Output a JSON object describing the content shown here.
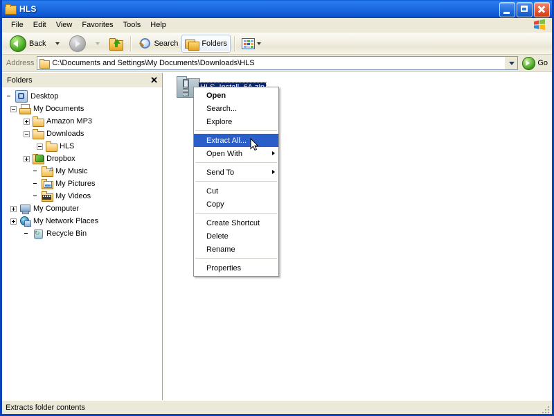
{
  "window": {
    "title": "HLS",
    "title_icon": "folder-icon",
    "buttons": {
      "minimize": "minimize",
      "maximize": "maximize",
      "close": "close"
    }
  },
  "menubar": {
    "items": [
      "File",
      "Edit",
      "View",
      "Favorites",
      "Tools",
      "Help"
    ],
    "brand_icon": "windows-flag-icon"
  },
  "toolbar": {
    "back": {
      "label": "Back",
      "icon": "back-arrow-icon",
      "enabled": true
    },
    "forward": {
      "label": "",
      "icon": "forward-arrow-icon",
      "enabled": false
    },
    "up": {
      "label": "",
      "icon": "up-folder-icon"
    },
    "search": {
      "label": "Search",
      "icon": "magnifier-icon"
    },
    "folders": {
      "label": "Folders",
      "icon": "folders-icon",
      "pressed": true
    },
    "views": {
      "label": "",
      "icon": "views-icon"
    }
  },
  "address": {
    "label": "Address",
    "icon": "folder-icon",
    "value": "C:\\Documents and Settings\\My Documents\\Downloads\\HLS",
    "dropdown_icon": "chevron-down-icon",
    "go_label": "Go",
    "go_icon": "go-arrow-icon"
  },
  "folders_pane": {
    "title": "Folders",
    "close_icon": "close-icon",
    "tree": [
      {
        "label": "Desktop",
        "icon": "desktop-icon",
        "indent": 0,
        "expander": "none"
      },
      {
        "label": "My Documents",
        "icon": "my-documents-icon",
        "indent": 1,
        "expander": "minus"
      },
      {
        "label": "Amazon MP3",
        "icon": "folder-icon",
        "indent": 2,
        "expander": "plus"
      },
      {
        "label": "Downloads",
        "icon": "folder-icon",
        "indent": 2,
        "expander": "minus"
      },
      {
        "label": "HLS",
        "icon": "folder-icon",
        "indent": 3,
        "expander": "minus"
      },
      {
        "label": "Dropbox",
        "icon": "dropbox-icon",
        "indent": 2,
        "expander": "plus"
      },
      {
        "label": "My Music",
        "icon": "my-music-icon",
        "indent": 2,
        "expander": "none"
      },
      {
        "label": "My Pictures",
        "icon": "my-pictures-icon",
        "indent": 2,
        "expander": "none"
      },
      {
        "label": "My Videos",
        "icon": "my-videos-icon",
        "indent": 2,
        "expander": "none"
      },
      {
        "label": "My Computer",
        "icon": "my-computer-icon",
        "indent": 1,
        "expander": "plus"
      },
      {
        "label": "My Network Places",
        "icon": "network-icon",
        "indent": 1,
        "expander": "plus"
      },
      {
        "label": "Recycle Bin",
        "icon": "recycle-bin-icon",
        "indent": 1,
        "expander": "none"
      }
    ]
  },
  "file_list": {
    "items": [
      {
        "name": "HLS_Install_6A.zip",
        "icon": "zip-folder-icon",
        "selected": true
      }
    ]
  },
  "context_menu": {
    "items": [
      {
        "label": "Open",
        "bold": true,
        "selected": false,
        "submenu": false
      },
      {
        "label": "Search...",
        "bold": false,
        "selected": false,
        "submenu": false
      },
      {
        "label": "Explore",
        "bold": false,
        "selected": false,
        "submenu": false
      },
      {
        "separator": true
      },
      {
        "label": "Extract All...",
        "bold": false,
        "selected": true,
        "submenu": false
      },
      {
        "label": "Open With",
        "bold": false,
        "selected": false,
        "submenu": true
      },
      {
        "separator": true
      },
      {
        "label": "Send To",
        "bold": false,
        "selected": false,
        "submenu": true
      },
      {
        "separator": true
      },
      {
        "label": "Cut",
        "bold": false,
        "selected": false,
        "submenu": false
      },
      {
        "label": "Copy",
        "bold": false,
        "selected": false,
        "submenu": false
      },
      {
        "separator": true
      },
      {
        "label": "Create Shortcut",
        "bold": false,
        "selected": false,
        "submenu": false
      },
      {
        "label": "Delete",
        "bold": false,
        "selected": false,
        "submenu": false
      },
      {
        "label": "Rename",
        "bold": false,
        "selected": false,
        "submenu": false
      },
      {
        "separator": true
      },
      {
        "label": "Properties",
        "bold": false,
        "selected": false,
        "submenu": false
      }
    ]
  },
  "statusbar": {
    "text": "Extracts folder contents"
  },
  "colors": {
    "title_bar_blue": "#0b59d2",
    "window_border": "#0a42b8",
    "face": "#ece9d8",
    "selection_blue": "#2a5fc9",
    "file_selection": "#0a246a"
  }
}
